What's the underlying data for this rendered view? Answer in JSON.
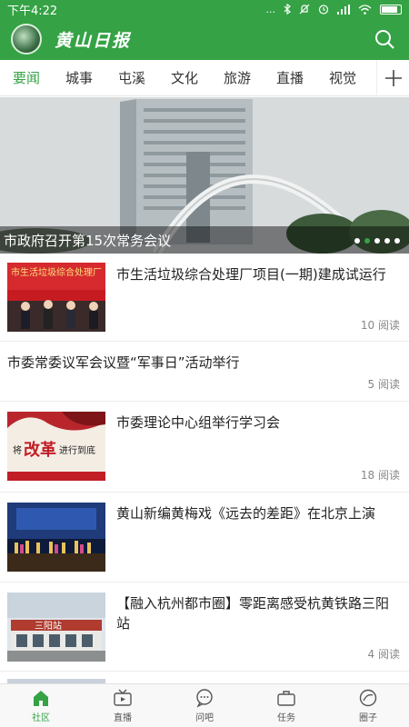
{
  "status": {
    "time": "下午4:22",
    "dots": "...",
    "icons": [
      "bluetooth-icon",
      "mute-icon",
      "alarm-icon",
      "signal-icon",
      "wifi-icon",
      "battery-icon"
    ]
  },
  "header": {
    "brand": "黄山日报",
    "search_icon": "search-icon"
  },
  "tabs": [
    {
      "label": "要闻",
      "active": true
    },
    {
      "label": "城事"
    },
    {
      "label": "屯溪"
    },
    {
      "label": "文化"
    },
    {
      "label": "旅游"
    },
    {
      "label": "直播"
    },
    {
      "label": "视觉"
    }
  ],
  "hero": {
    "caption": "市政府召开第15次常务会议",
    "slide_count": 5,
    "active_slide": 2
  },
  "news": [
    {
      "title": "市生活垃圾综合处理厂项目(一期)建成试运行",
      "reads": "10 阅读",
      "thumb_text": "市生活垃圾综合处理厂"
    },
    {
      "title": "市委常委议军会议暨“军事日”活动举行",
      "reads": "5 阅读"
    },
    {
      "title": "市委理论中心组举行学习会",
      "reads": "18 阅读",
      "thumb_text_big": "改革",
      "thumb_text_pre": "将",
      "thumb_text_post": "进行到底"
    },
    {
      "title": "黄山新编黄梅戏《远去的差距》在北京上演",
      "reads": ""
    },
    {
      "title": "【融入杭州都市圈】零距离感受杭黄铁路三阳站",
      "reads": "4 阅读",
      "thumb_text": "三阳站"
    }
  ],
  "nav": [
    {
      "label": "社区",
      "icon": "home-icon",
      "active": true
    },
    {
      "label": "直播",
      "icon": "tv-icon"
    },
    {
      "label": "问吧",
      "icon": "chat-icon"
    },
    {
      "label": "任务",
      "icon": "briefcase-icon"
    },
    {
      "label": "圈子",
      "icon": "circle-pen-icon"
    }
  ],
  "colors": {
    "brand_green": "#35a245"
  }
}
